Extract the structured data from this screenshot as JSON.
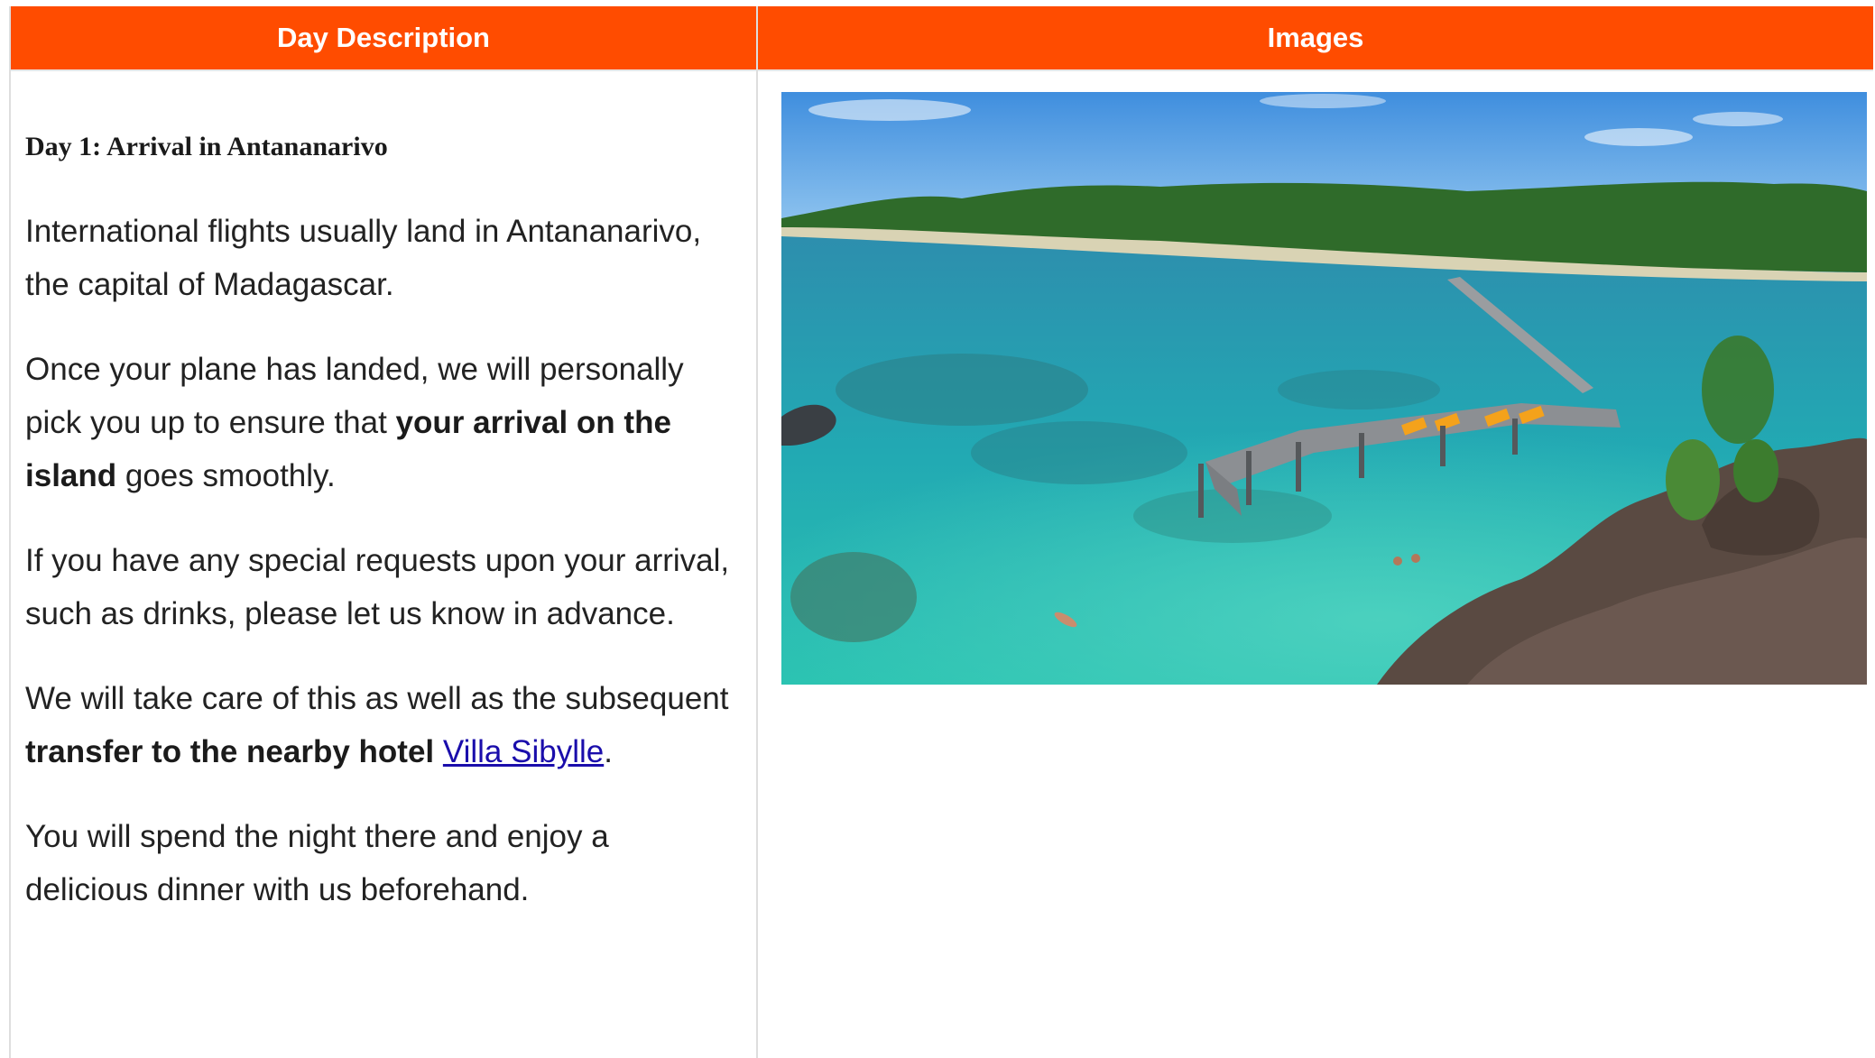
{
  "table": {
    "headers": {
      "description": "Day Description",
      "images": "Images"
    }
  },
  "day": {
    "title": "Day 1: Arrival in Antananarivo",
    "paragraphs": {
      "p1": "International flights usually land in Antananarivo, the capital of Madagascar.",
      "p2_before": "Once your plane has landed, we will personally pick you up to ensure that ",
      "p2_bold": "your arrival on the island",
      "p2_after": " goes smoothly.",
      "p3": "If you have any special requests upon your arrival, such as drinks, please let us know in advance.",
      "p4_before": "We will take care of this as well as the subsequent ",
      "p4_bold": "transfer to the nearby hotel",
      "p4_space": " ",
      "p4_link": "Villa Sibylle",
      "p4_after": ".",
      "p5": "You will spend the night there and enjoy a delicious dinner with us beforehand."
    }
  },
  "colors": {
    "header_bg": "#ff4c00",
    "header_text": "#ffffff",
    "link": "#1a0dab"
  }
}
